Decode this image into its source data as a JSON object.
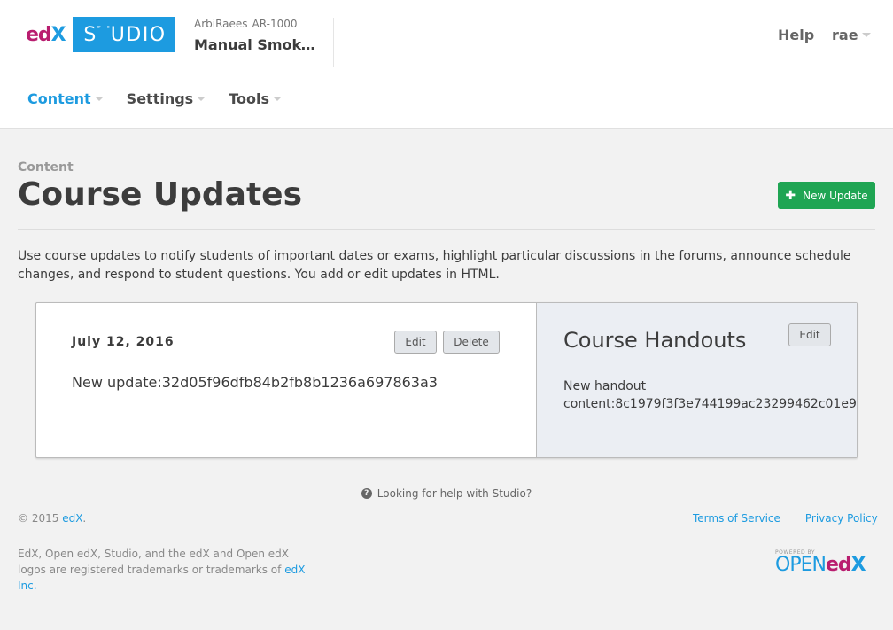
{
  "header": {
    "logo": {
      "edx_text": "edX",
      "studio_text": "STUDIO"
    },
    "course": {
      "org": "ArbiRaees",
      "number": "AR-1000",
      "title": "Manual Smoke T..."
    },
    "help_label": "Help",
    "user_label": "rae",
    "nav": [
      {
        "label": "Content",
        "active": true
      },
      {
        "label": "Settings",
        "active": false
      },
      {
        "label": "Tools",
        "active": false
      }
    ]
  },
  "page": {
    "section_label": "Content",
    "title": "Course Updates",
    "new_update_label": "New Update",
    "intro": "Use course updates to notify students of important dates or exams, highlight particular discussions in the forums, announce schedule changes, and respond to student questions. You add or edit updates in HTML."
  },
  "update": {
    "date": "July 12, 2016",
    "content": "New update:32d05f96dfb84b2fb8b1236a697863a3",
    "edit_label": "Edit",
    "delete_label": "Delete"
  },
  "handouts": {
    "title": "Course Handouts",
    "edit_label": "Edit",
    "content": "New handout content:8c1979f3f3e744199ac23299462c01e9"
  },
  "footer": {
    "help_text": "Looking for help with Studio?",
    "copyright_prefix": "© 2015",
    "copyright_link": "edX",
    "terms_label": "Terms of Service",
    "privacy_label": "Privacy Policy",
    "trademark_text": "EdX, Open edX, Studio, and the edX and Open edX logos are registered trademarks or trademarks of",
    "trademark_link": "edX Inc.",
    "powered_by": "POWERED BY",
    "powered_open": "OPEN",
    "powered_edx": "edX"
  },
  "colors": {
    "accent": "#1d9be0",
    "brand_magenta": "#b91d6f",
    "success": "#1fa553"
  }
}
